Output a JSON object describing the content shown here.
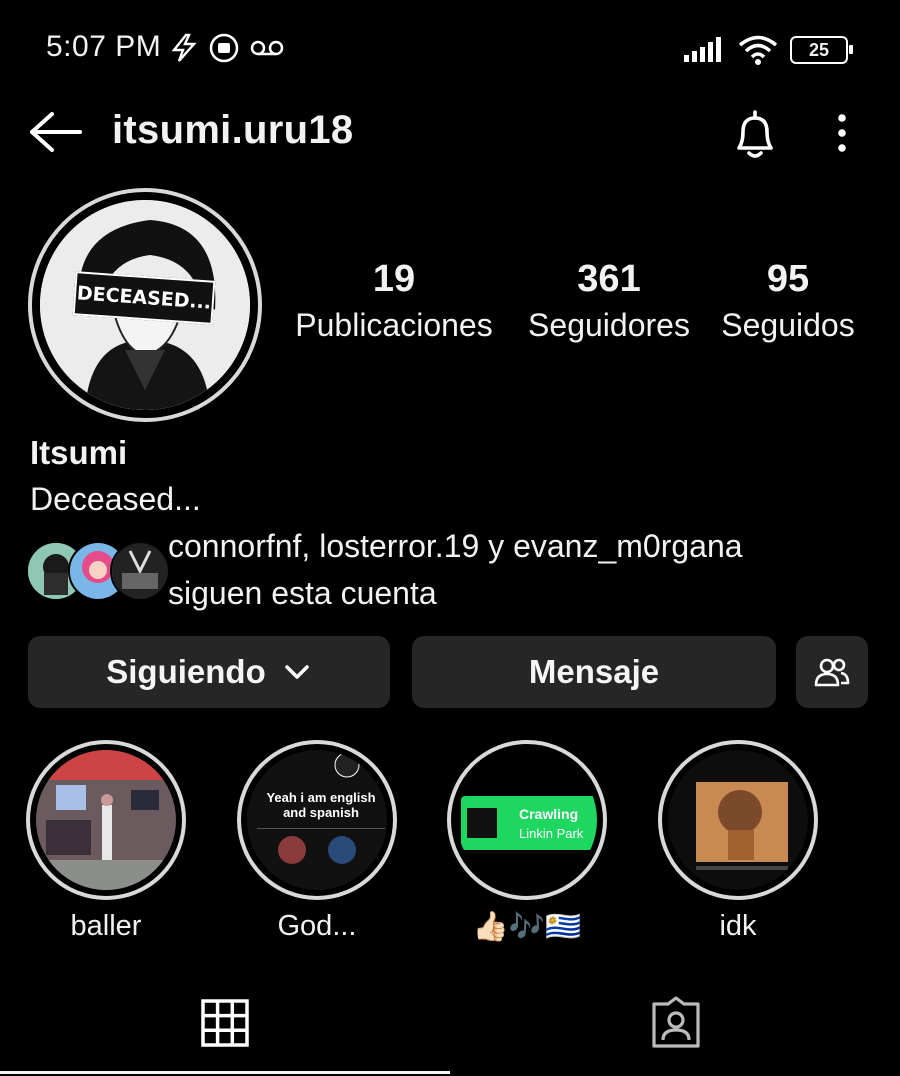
{
  "status_bar": {
    "time": "5:07 PM",
    "battery": "25"
  },
  "header": {
    "username": "itsumi.uru18"
  },
  "profile": {
    "avatar_text": "DECEASED...",
    "stats": [
      {
        "value": "19",
        "label": "Publicaciones"
      },
      {
        "value": "361",
        "label": "Seguidores"
      },
      {
        "value": "95",
        "label": "Seguidos"
      }
    ],
    "name": "Itsumi",
    "bio": "Deceased...",
    "followed_by_line1": "connorfnf, losterror.19 y evanz_m0rgana",
    "followed_by_line2": "siguen esta cuenta"
  },
  "actions": {
    "following": "Siguiendo",
    "message": "Mensaje"
  },
  "highlights": [
    {
      "label": "baller"
    },
    {
      "label": "God...",
      "thumb_title": "Yeah i am english and spanish"
    },
    {
      "label": "👍🏻🎶🇺🇾",
      "thumb_title": "Crawling",
      "thumb_subtitle": "Linkin Park"
    },
    {
      "label": "idk"
    }
  ],
  "colors": {
    "background": "#000000",
    "button": "#262626",
    "ring": "#d9d9d9",
    "spotify_green": "#1ed760"
  }
}
